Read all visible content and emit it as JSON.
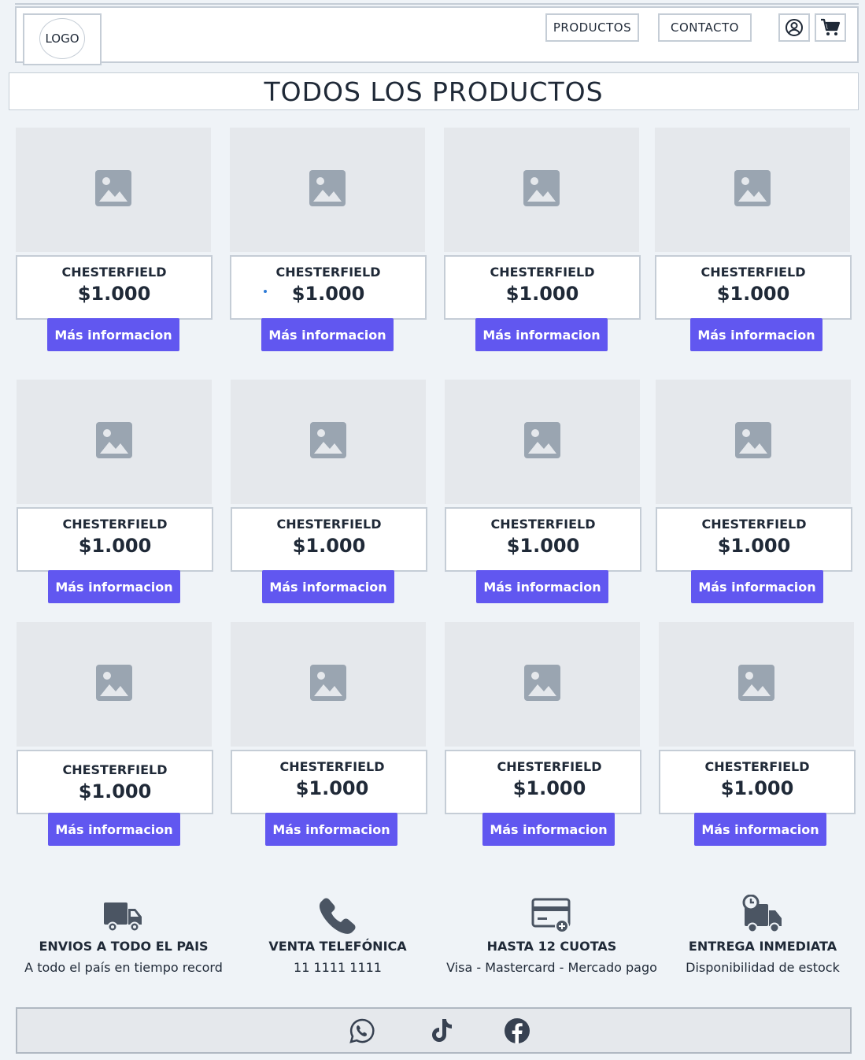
{
  "header": {
    "logo": "LOGO",
    "nav": [
      {
        "label": "PRODUCTOS"
      },
      {
        "label": "CONTACTO"
      }
    ],
    "icons": [
      "user-icon",
      "cart-icon"
    ]
  },
  "page": {
    "title": "TODOS LOS PRODUCTOS"
  },
  "products": [
    {
      "name": "CHESTERFIELD",
      "price": "$1.000",
      "button": "Más informacion"
    },
    {
      "name": "CHESTERFIELD",
      "price": "$1.000",
      "button": "Más informacion"
    },
    {
      "name": "CHESTERFIELD",
      "price": "$1.000",
      "button": "Más informacion"
    },
    {
      "name": "CHESTERFIELD",
      "price": "$1.000",
      "button": "Más informacion"
    },
    {
      "name": "CHESTERFIELD",
      "price": "$1.000",
      "button": "Más informacion"
    },
    {
      "name": "CHESTERFIELD",
      "price": "$1.000",
      "button": "Más informacion"
    },
    {
      "name": "CHESTERFIELD",
      "price": "$1.000",
      "button": "Más informacion"
    },
    {
      "name": "CHESTERFIELD",
      "price": "$1.000",
      "button": "Más informacion"
    },
    {
      "name": "CHESTERFIELD",
      "price": "$1.000",
      "button": "Más informacion"
    },
    {
      "name": "CHESTERFIELD",
      "price": "$1.000",
      "button": "Más informacion"
    },
    {
      "name": "CHESTERFIELD",
      "price": "$1.000",
      "button": "Más informacion"
    },
    {
      "name": "CHESTERFIELD",
      "price": "$1.000",
      "button": "Más informacion"
    }
  ],
  "features": [
    {
      "icon": "truck-icon",
      "title": "ENVIOS A TODO EL PAIS",
      "subtitle": "A todo el país en tiempo record"
    },
    {
      "icon": "phone-icon",
      "title": "VENTA TELEFÓNICA",
      "subtitle": "11 1111 1111"
    },
    {
      "icon": "credit-card-icon",
      "title": "HASTA 12 CUOTAS",
      "subtitle": "Visa - Mastercard - Mercado pago"
    },
    {
      "icon": "delivery-clock-icon",
      "title": "ENTREGA INMEDIATA",
      "subtitle": "Disponibilidad de estock"
    }
  ],
  "footer": {
    "social": [
      "whatsapp-icon",
      "tiktok-icon",
      "facebook-icon"
    ]
  },
  "colors": {
    "accent": "#6157f0",
    "background": "#eff3f7",
    "border": "#c5cdd6",
    "placeholder": "#e5e8ec",
    "icon": "#9aa5b1",
    "feature_icon": "#4b5563"
  }
}
